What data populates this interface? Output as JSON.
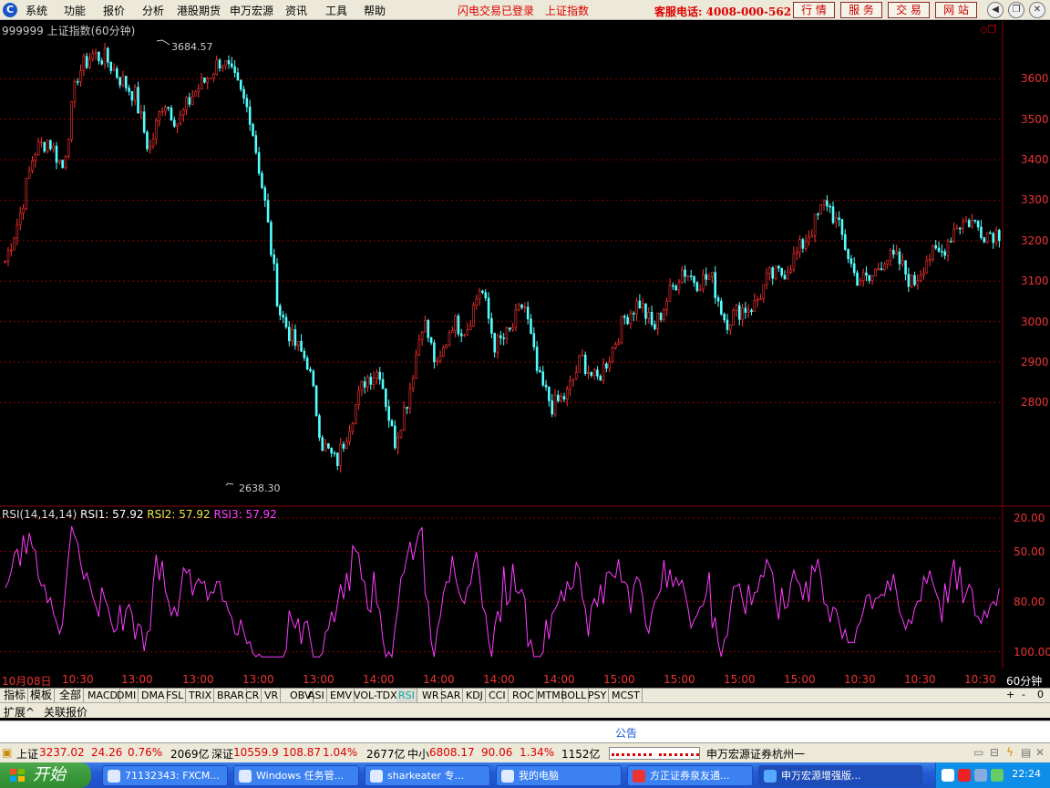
{
  "menu": {
    "items": [
      "系统",
      "功能",
      "报价",
      "分析",
      "港股期货",
      "申万宏源",
      "资讯",
      "工具",
      "帮助"
    ],
    "status_login": "闪电交易已登录",
    "status_index": "上证指数",
    "phone": "客服电话: 4008-000-562",
    "right_buttons": [
      "行 情",
      "服 务",
      "交 易",
      "网 站"
    ]
  },
  "chart": {
    "title": "999999 上证指数(60分钟)",
    "high_label": "3684.57",
    "low_label": "2638.30",
    "price_ticks": [
      "3600",
      "3500",
      "3400",
      "3300",
      "3200",
      "3100",
      "3000",
      "2900",
      "2800"
    ],
    "rsi_label": "RSI(14,14,14)",
    "rsi1": "RSI1: 57.92",
    "rsi2": "RSI2: 57.92",
    "rsi3": "RSI3: 57.92",
    "rsi_ticks": [
      "100.00",
      "80.00",
      "50.00",
      "20.00"
    ],
    "time_labels": [
      "10月08日",
      "10:30",
      "13:00",
      "13:00",
      "13:00",
      "13:00",
      "14:00",
      "14:00",
      "14:00",
      "14:00",
      "15:00",
      "15:00",
      "15:00",
      "15:00",
      "10:30",
      "10:30",
      "10:30"
    ],
    "period": "60分钟",
    "colors": {
      "up": "#ff3232",
      "down": "#54ffff",
      "rsi": "#ff3cff",
      "grid": "#8b0000"
    }
  },
  "chart_data": {
    "type": "candlestick",
    "title": "999999 上证指数(60分钟)",
    "close_path": [
      3150,
      3260,
      3420,
      3450,
      3380,
      3610,
      3660,
      3650,
      3600,
      3560,
      3420,
      3550,
      3490,
      3560,
      3600,
      3650,
      3590,
      3510,
      3300,
      3030,
      2950,
      2900,
      2700,
      2650,
      2760,
      2860,
      2880,
      2700,
      2820,
      3010,
      2880,
      3000,
      2980,
      3090,
      2940,
      2970,
      3050,
      2860,
      2790,
      2820,
      2910,
      2850,
      2920,
      3010,
      3050,
      2980,
      3060,
      3130,
      3100,
      3110,
      3000,
      3030,
      3040,
      3110,
      3120,
      3170,
      3230,
      3300,
      3220,
      3110,
      3100,
      3160,
      3150,
      3090,
      3160,
      3170,
      3240,
      3250,
      3220,
      3220
    ],
    "high": 3684.57,
    "low": 2638.3,
    "ylim": [
      2560,
      3720
    ],
    "yticks": [
      2800,
      2900,
      3000,
      3100,
      3200,
      3300,
      3400,
      3500,
      3600
    ],
    "rsi": {
      "name": "RSI(14,14,14)",
      "last": 57.92,
      "ylim": [
        10,
        100
      ],
      "ticks": [
        20,
        50,
        80,
        100
      ]
    }
  },
  "bottom": {
    "minus": "-",
    "zero": "0",
    "plus": "+"
  },
  "tabs": [
    "指标",
    "模板",
    "全部",
    "MACD",
    "DMI",
    "DMA",
    "FSL",
    "TRIX",
    "BRAR",
    "CR",
    "VR",
    "OBV",
    "ASI",
    "EMV",
    "VOL-TDX",
    "RSI",
    "WR",
    "SAR",
    "KDJ",
    "CCI",
    "ROC",
    "MTM",
    "BOLL",
    "PSY",
    "MCST"
  ],
  "active_tab": "RSI",
  "ext": {
    "expand": "扩展^",
    "related": "关联报价"
  },
  "notice": "公告",
  "statusbar": {
    "sh_name": "上证",
    "sh_val": "3237.02",
    "sh_chg": "24.26",
    "sh_pct": "0.76%",
    "sh_amt": "2069亿",
    "sz_name": "深证",
    "sz_val": "10559.9",
    "sz_chg": "108.87",
    "sz_pct": "1.04%",
    "sz_amt": "2677亿",
    "zx_name": "中小",
    "zx_val": "6808.17",
    "zx_chg": "90.06",
    "zx_pct": "1.34%",
    "zx_amt": "1152亿",
    "broker": "申万宏源证券杭州一"
  },
  "taskbar": {
    "start": "开始",
    "items": [
      "71132343: FXCM...",
      "Windows 任务管...",
      "sharkeater 专...",
      "我的电脑",
      "方正证券泉友通...",
      "申万宏源增强版..."
    ],
    "clock": "22:24"
  }
}
